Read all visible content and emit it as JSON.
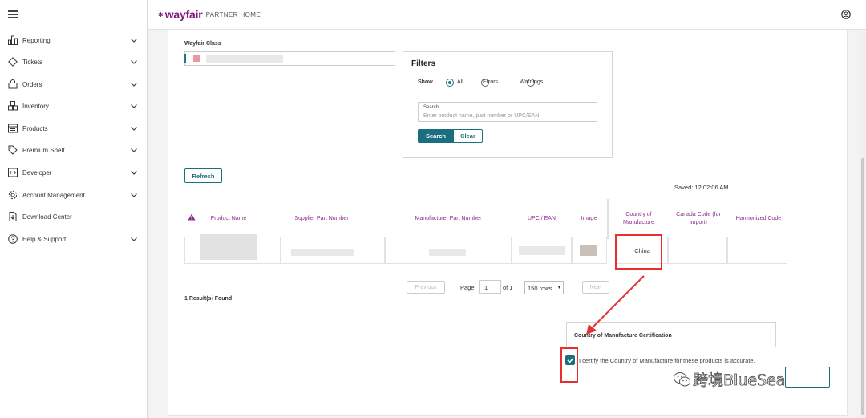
{
  "header": {
    "brand": "wayfair",
    "brand_suffix": "PARTNER HOME",
    "accent_color": "#7f187f",
    "primary_color": "#1b6e7e"
  },
  "sidebar": {
    "items": [
      {
        "label": "Reporting",
        "icon": "bar-chart-icon",
        "has_chevron": true
      },
      {
        "label": "Tickets",
        "icon": "ticket-icon",
        "has_chevron": true
      },
      {
        "label": "Orders",
        "icon": "bag-icon",
        "has_chevron": true
      },
      {
        "label": "Inventory",
        "icon": "boxes-icon",
        "has_chevron": true
      },
      {
        "label": "Products",
        "icon": "catalog-icon",
        "has_chevron": true
      },
      {
        "label": "Premium Shelf",
        "icon": "tag-icon",
        "has_chevron": true
      },
      {
        "label": "Developer",
        "icon": "code-icon",
        "has_chevron": true
      },
      {
        "label": "Account Management",
        "icon": "gear-icon",
        "has_chevron": true
      },
      {
        "label": "Download Center",
        "icon": "download-icon",
        "has_chevron": false
      },
      {
        "label": "Help & Support",
        "icon": "help-icon",
        "has_chevron": true
      }
    ]
  },
  "main": {
    "wayfair_class_label": "Wayfair Class",
    "filters": {
      "title": "Filters",
      "show_label": "Show",
      "options": [
        "All",
        "Errors",
        "Warnings"
      ],
      "selected": "All",
      "search_label": "Search",
      "search_placeholder": "Enter product name, part number or UPC/EAN",
      "search_button": "Search",
      "clear_button": "Clear"
    },
    "refresh_button": "Refresh",
    "saved_text": "Saved: 12:02:06 AM",
    "table": {
      "columns": [
        "Product Name",
        "Supplier Part Number",
        "Manufacturer Part Number",
        "UPC / EAN",
        "Image",
        "Country of Manufacture",
        "Canada Code (for import)",
        "Harmonized Code"
      ],
      "rows": [
        {
          "country_of_manufacture": "China"
        }
      ]
    },
    "pagination": {
      "previous": "Previous",
      "page_label": "Page",
      "page_value": "1",
      "of_label": "of 1",
      "rows_selected": "150 rows",
      "next": "Next"
    },
    "results_text": "1 Result(s) Found",
    "certification": {
      "title": "Country of Manufacture Certification",
      "checkbox_label": "I certify the Country of Manufacture for these products is accurate.",
      "checked": true
    },
    "watermark": "跨境BlueSea"
  }
}
